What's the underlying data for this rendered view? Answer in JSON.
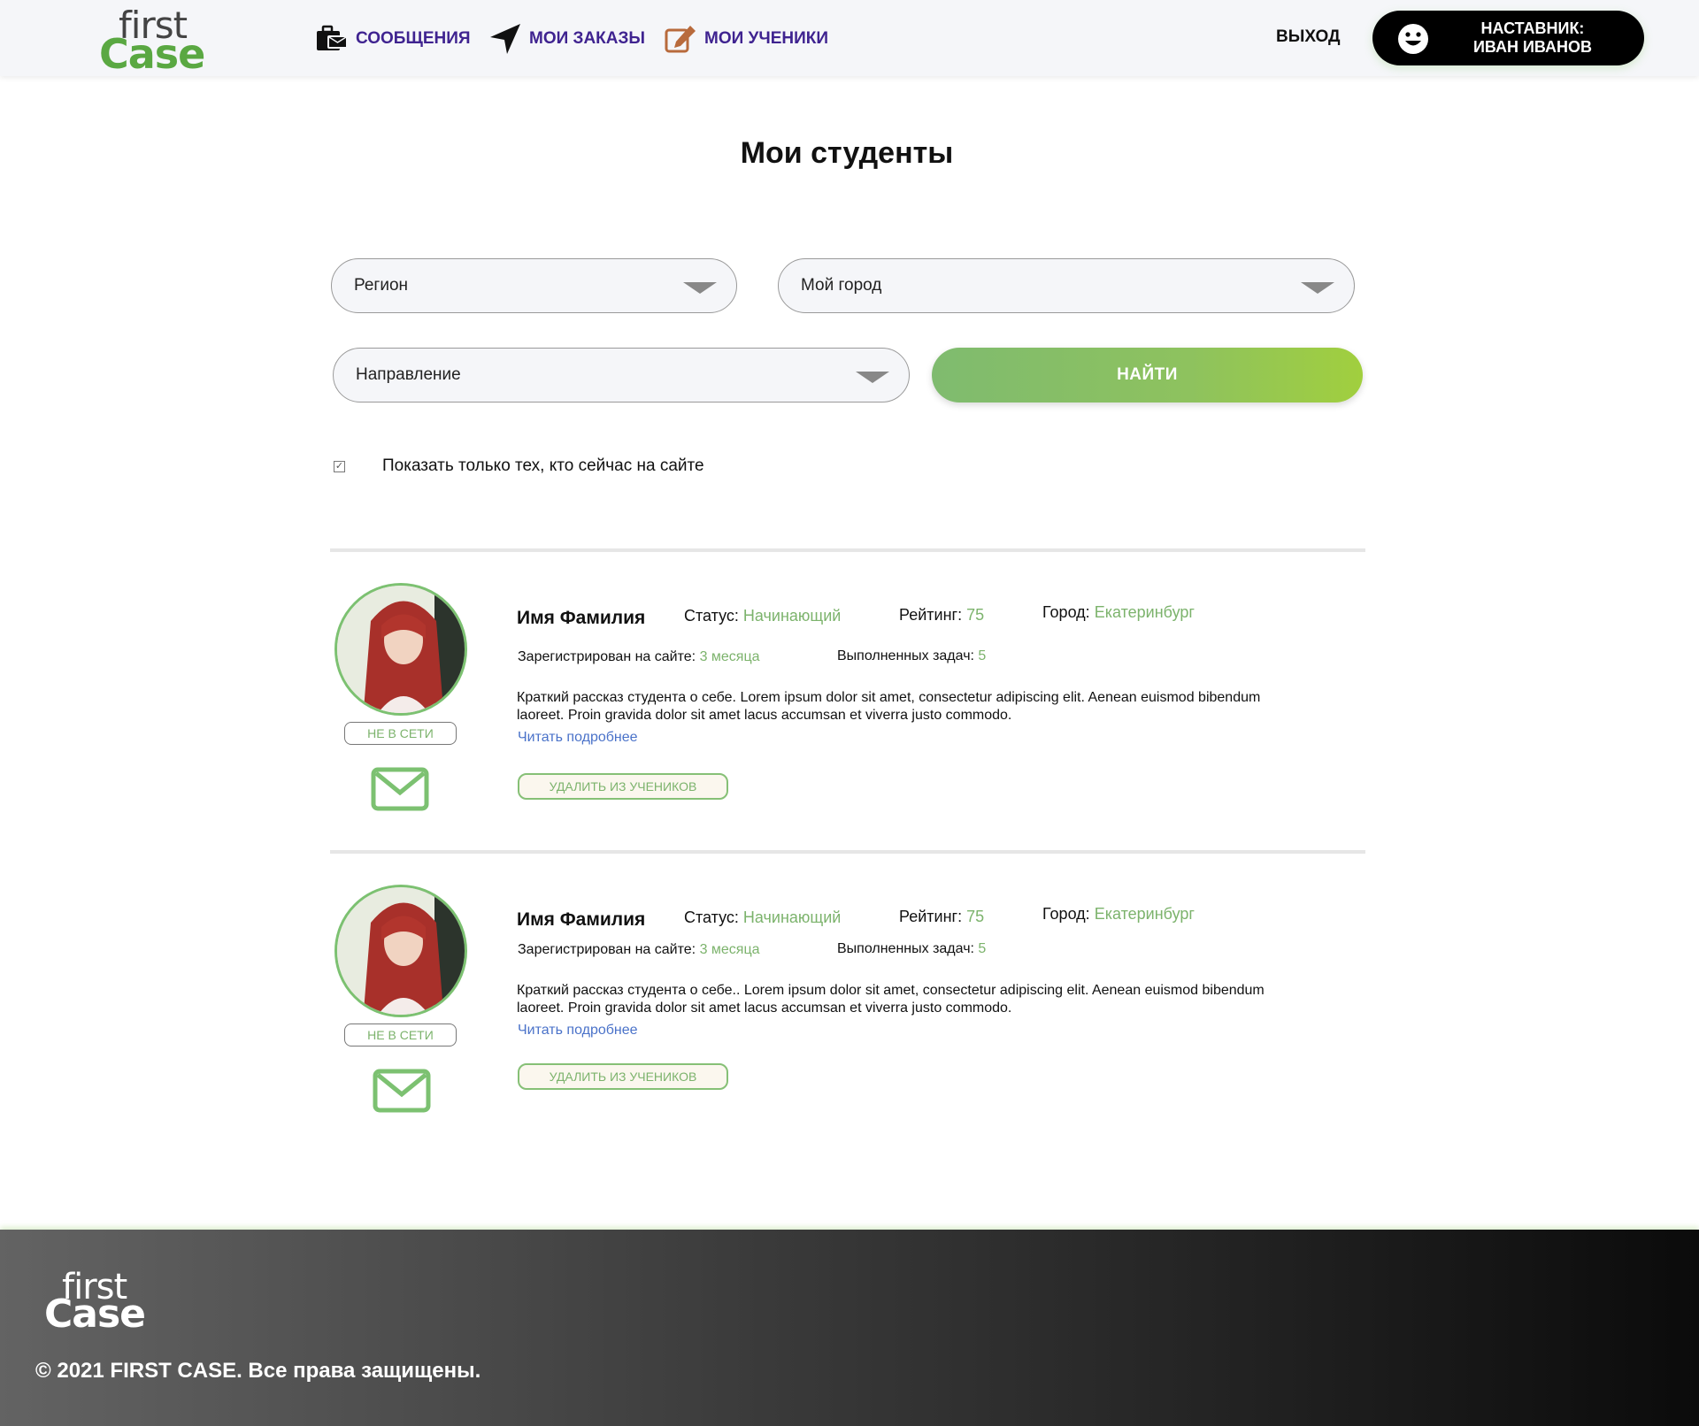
{
  "brand": {
    "logo_top": "first",
    "logo_bottom": "Case",
    "accent": "#5aa842",
    "nav_color": "#3f2390"
  },
  "nav": {
    "messages": "СООБЩЕНИЯ",
    "orders": "МОИ ЗАКАЗЫ",
    "students": "МОИ УЧЕНИКИ",
    "logout": "ВЫХОД",
    "mentor_line1": "НАСТАВНИК:",
    "mentor_line2": "ИВАН ИВАНОВ"
  },
  "page": {
    "title": "Мои студенты"
  },
  "filters": {
    "region": "Регион",
    "city": "Мой город",
    "direction": "Направление",
    "find": "НАЙТИ",
    "online_only_label": "Показать только тех, кто сейчас на сайте",
    "online_only_checked": true
  },
  "labels": {
    "status": "Статус:",
    "rating": "Рейтинг:",
    "city": "Город:",
    "registered": "Зарегистрирован на сайте:",
    "tasks": "Выполненных задач:",
    "read_more": "Читать подробнее",
    "remove": "УДАЛИТЬ ИЗ УЧЕНИКОВ",
    "offline": "НЕ В СЕТИ"
  },
  "students": [
    {
      "name": "Имя Фамилия",
      "status": "Начинающий",
      "rating": "75",
      "city": "Екатеринбург",
      "registered": "3 месяца",
      "tasks": "5",
      "about": "Краткий рассказ студента о себе. Lorem ipsum dolor sit amet, consectetur adipiscing elit. Aenean euismod bibendum laoreet. Proin gravida dolor sit amet lacus accumsan et viverra justo commodo.",
      "presence": "НЕ В СЕТИ"
    },
    {
      "name": "Имя Фамилия",
      "status": "Начинающий",
      "rating": "75",
      "city": "Екатеринбург",
      "registered": "3 месяца",
      "tasks": "5",
      "about": "Краткий рассказ студента о себе.. Lorem ipsum dolor sit amet, consectetur adipiscing elit. Aenean euismod bibendum laoreet. Proin gravida dolor sit amet lacus accumsan et viverra justo commodo.",
      "presence": "НЕ В СЕТИ"
    }
  ],
  "footer": {
    "logo_top": "first",
    "logo_bottom": "Case",
    "copyright": "© 2021 FIRST CASE. Все права защищены."
  },
  "icons": {
    "messages": "briefcase-icon",
    "orders": "paper-plane-icon",
    "students": "edit-icon",
    "mentor": "smiley-icon",
    "mail": "envelope-icon"
  }
}
